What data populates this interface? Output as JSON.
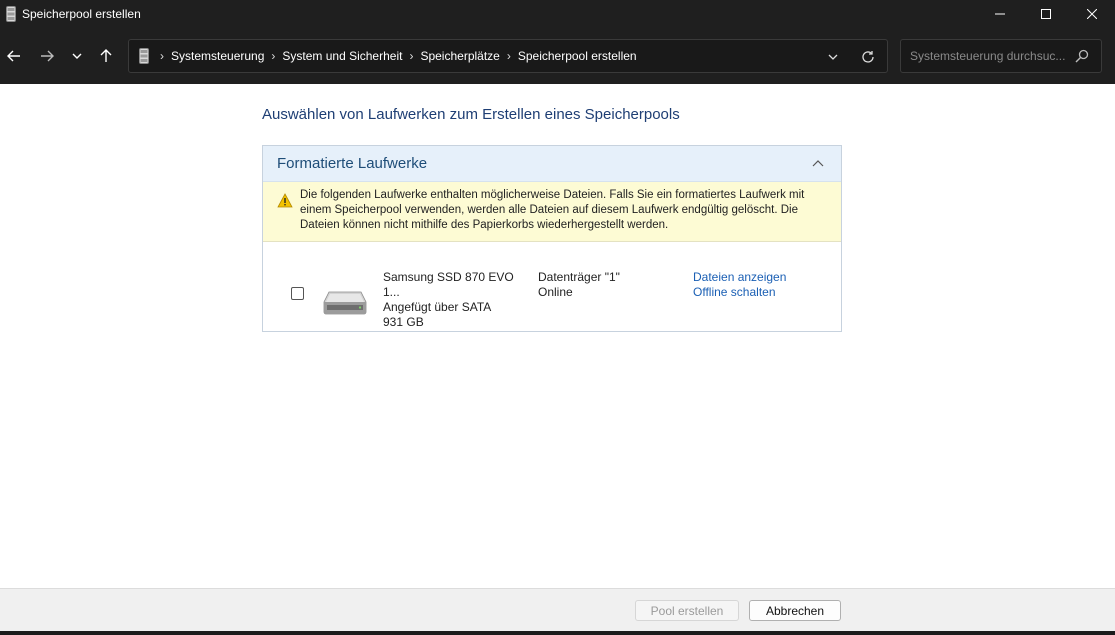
{
  "window": {
    "title": "Speicherpool erstellen",
    "app_icon": "storage-spaces-icon"
  },
  "titlebar_controls": [
    "minimize-icon",
    "maximize-icon",
    "close-icon"
  ],
  "navigation": {
    "buttons": [
      "back-arrow-icon",
      "forward-arrow-icon",
      "recent-locations-chevron-icon",
      "up-arrow-icon"
    ],
    "breadcrumbs": [
      "Systemsteuerung",
      "System und Sicherheit",
      "Speicherplätze",
      "Speicherpool erstellen"
    ],
    "search_placeholder": "Systemsteuerung durchsuc..."
  },
  "main": {
    "heading": "Auswählen von Laufwerken zum Erstellen eines Speicherpools",
    "group": {
      "title": "Formatierte Laufwerke",
      "warning": "Die folgenden Laufwerke enthalten möglicherweise Dateien. Falls Sie ein formatiertes Laufwerk mit einem Speicherpool verwenden, werden alle Dateien auf diesem Laufwerk endgültig gelöscht. Die Dateien können nicht mithilfe des Papierkorbs wiederhergestellt werden.",
      "drives": [
        {
          "checked": false,
          "name": "Samsung SSD 870 EVO 1...",
          "connection": "Angefügt über SATA",
          "size": "931 GB",
          "disk": "Datenträger \"1\"",
          "status": "Online",
          "link_view": "Dateien anzeigen",
          "link_offline": "Offline schalten"
        }
      ]
    }
  },
  "footer": {
    "create_label": "Pool erstellen",
    "create_enabled": false,
    "cancel_label": "Abbrechen"
  },
  "colors": {
    "chrome": "#1f1f1f",
    "heading": "#1e3e74",
    "group_header_bg": "#e6f0fa",
    "warning_bg": "#fdfbd4",
    "link": "#1a5fb4"
  }
}
